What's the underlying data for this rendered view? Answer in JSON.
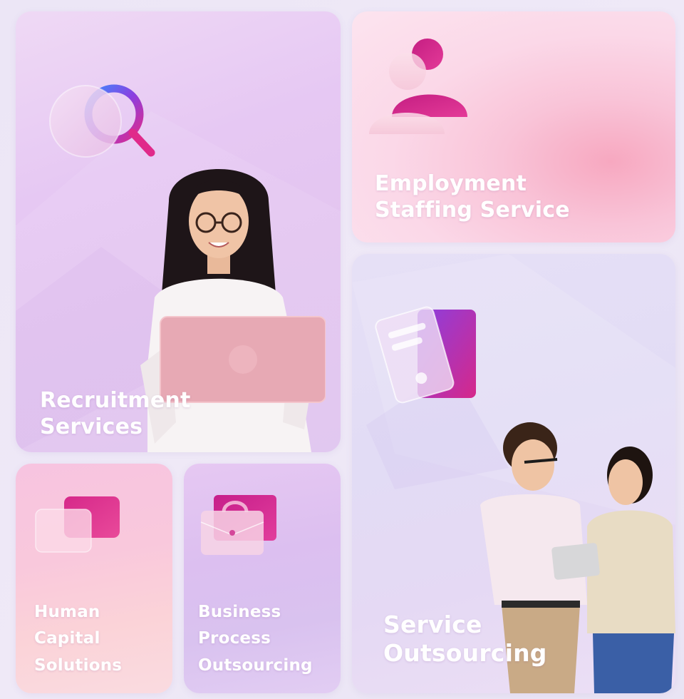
{
  "cards": {
    "recruitment": {
      "line1": "Recruitment",
      "line2": "Services",
      "icon": "search-icon"
    },
    "employment": {
      "line1": "Employment",
      "line2": "Staffing Service",
      "icon": "user-icon"
    },
    "human_capital": {
      "line1": "Human",
      "line2": "Capital",
      "line3": "Solutions",
      "icon": "chat-icon"
    },
    "business_process": {
      "line1": "Business",
      "line2": "Process",
      "line3": "Outsourcing",
      "icon": "briefcase-icon"
    },
    "service_outsourcing": {
      "line1": "Service",
      "line2": "Outsourcing",
      "icon": "document-icon"
    }
  },
  "colors": {
    "accent_magenta": "#d62a8c",
    "accent_purple": "#8a3fe0",
    "accent_blue": "#3f7bff",
    "title_text": "#ffffff"
  }
}
